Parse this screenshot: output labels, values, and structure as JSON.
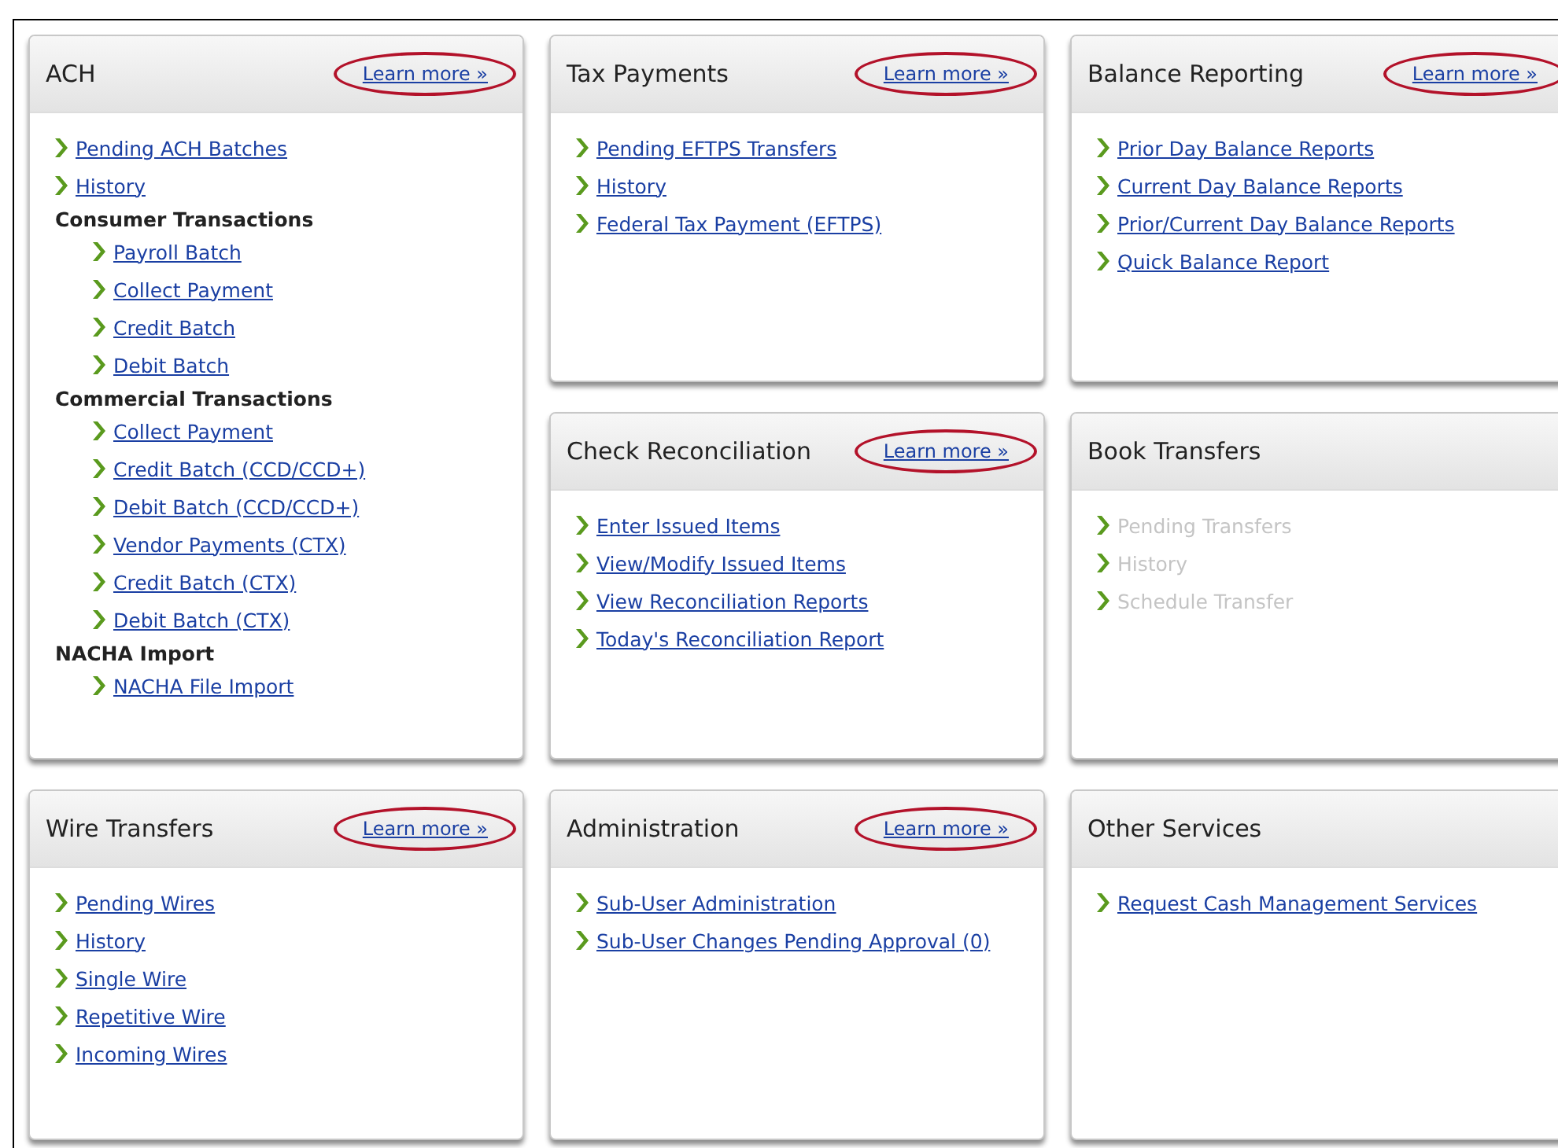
{
  "cards": [
    {
      "title": "ACH",
      "learn_more": {
        "label": "Learn more »",
        "circled": true
      },
      "items": [
        {
          "kind": "link",
          "label": "Pending ACH Batches",
          "disabled": false
        },
        {
          "kind": "link",
          "label": "History",
          "disabled": false
        },
        {
          "kind": "group",
          "label": "Consumer Transactions",
          "children": [
            {
              "kind": "link",
              "label": "Payroll Batch",
              "disabled": false
            },
            {
              "kind": "link",
              "label": "Collect Payment",
              "disabled": false
            },
            {
              "kind": "link",
              "label": "Credit Batch",
              "disabled": false
            },
            {
              "kind": "link",
              "label": "Debit Batch",
              "disabled": false
            }
          ]
        },
        {
          "kind": "group",
          "label": "Commercial Transactions",
          "children": [
            {
              "kind": "link",
              "label": "Collect Payment",
              "disabled": false
            },
            {
              "kind": "link",
              "label": "Credit Batch (CCD/CCD+)",
              "disabled": false
            },
            {
              "kind": "link",
              "label": "Debit Batch (CCD/CCD+)",
              "disabled": false
            },
            {
              "kind": "link",
              "label": "Vendor Payments (CTX)",
              "disabled": false
            },
            {
              "kind": "link",
              "label": "Credit Batch (CTX)",
              "disabled": false
            },
            {
              "kind": "link",
              "label": "Debit Batch (CTX)",
              "disabled": false
            }
          ]
        },
        {
          "kind": "group",
          "label": "NACHA Import",
          "children": [
            {
              "kind": "link",
              "label": "NACHA File Import",
              "disabled": false
            }
          ]
        }
      ]
    },
    {
      "title": "Tax Payments",
      "learn_more": {
        "label": "Learn more »",
        "circled": true
      },
      "items": [
        {
          "kind": "link",
          "label": "Pending EFTPS Transfers",
          "disabled": false
        },
        {
          "kind": "link",
          "label": "History",
          "disabled": false
        },
        {
          "kind": "link",
          "label": "Federal Tax Payment (EFTPS)",
          "disabled": false
        }
      ]
    },
    {
      "title": "Balance Reporting",
      "learn_more": {
        "label": "Learn more »",
        "circled": true
      },
      "items": [
        {
          "kind": "link",
          "label": "Prior Day Balance Reports",
          "disabled": false
        },
        {
          "kind": "link",
          "label": "Current Day Balance Reports",
          "disabled": false
        },
        {
          "kind": "link",
          "label": "Prior/Current Day Balance Reports",
          "disabled": false
        },
        {
          "kind": "link",
          "label": "Quick Balance Report",
          "disabled": false
        }
      ]
    },
    {
      "title": "Check Reconciliation",
      "learn_more": {
        "label": "Learn more »",
        "circled": true
      },
      "items": [
        {
          "kind": "link",
          "label": "Enter Issued Items",
          "disabled": false
        },
        {
          "kind": "link",
          "label": "View/Modify Issued Items",
          "disabled": false
        },
        {
          "kind": "link",
          "label": "View Reconciliation Reports",
          "disabled": false
        },
        {
          "kind": "link",
          "label": "Today's Reconciliation Report",
          "disabled": false
        }
      ]
    },
    {
      "title": "Book Transfers",
      "items": [
        {
          "kind": "link",
          "label": "Pending Transfers",
          "disabled": true
        },
        {
          "kind": "link",
          "label": "History",
          "disabled": true
        },
        {
          "kind": "link",
          "label": "Schedule Transfer",
          "disabled": true
        }
      ]
    },
    {
      "title": "Wire Transfers",
      "learn_more": {
        "label": "Learn more »",
        "circled": true
      },
      "items": [
        {
          "kind": "link",
          "label": "Pending Wires",
          "disabled": false
        },
        {
          "kind": "link",
          "label": "History",
          "disabled": false
        },
        {
          "kind": "link",
          "label": "Single Wire",
          "disabled": false
        },
        {
          "kind": "link",
          "label": "Repetitive Wire",
          "disabled": false
        },
        {
          "kind": "link",
          "label": "Incoming Wires",
          "disabled": false
        }
      ]
    },
    {
      "title": "Administration",
      "learn_more": {
        "label": "Learn more »",
        "circled": true
      },
      "items": [
        {
          "kind": "link",
          "label": "Sub-User Administration",
          "disabled": false
        },
        {
          "kind": "link",
          "label": "Sub-User Changes Pending Approval (0)",
          "disabled": false
        }
      ]
    },
    {
      "title": "Other Services",
      "items": [
        {
          "kind": "link",
          "label": "Request Cash Management Services",
          "disabled": false
        }
      ]
    }
  ]
}
